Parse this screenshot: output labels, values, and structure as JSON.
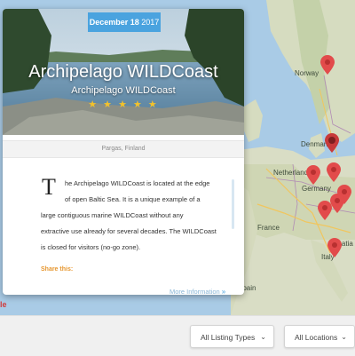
{
  "map": {
    "labels": {
      "norway": "Norway",
      "denmark": "Denmark",
      "netherlands": "Netherlands",
      "germany": "Germany",
      "france": "France",
      "italy": "Italy",
      "croatia": "Croatia",
      "spain": "Spain"
    },
    "water_color": "#a9cbe6",
    "land_color": "#d9ddc5",
    "pin_color": "#e24b4b"
  },
  "card": {
    "date_bold": "December 18",
    "date_year": "2017",
    "title": "Archipelago WILDCoast",
    "subtitle": "Archipelago WILDCoast",
    "stars": "★ ★ ★ ★ ★",
    "location": "Pargas, Finland",
    "dropcap": "T",
    "description_lines": [
      "he Archipelago WILDCoast is located at the edge",
      "of open Baltic Sea. It is a unique example of a",
      "large contiguous marine WILDCoast without any",
      "extractive use already for several decades. The WILDCoast",
      "is closed for visitors (no-go zone)."
    ],
    "share_label": "Share this:",
    "more_info": "More Information",
    "more_arrow": "»"
  },
  "filters": {
    "listing_types": "All Listing Types",
    "locations": "All Locations",
    "caret": "⌄"
  },
  "google_fragment": "le"
}
